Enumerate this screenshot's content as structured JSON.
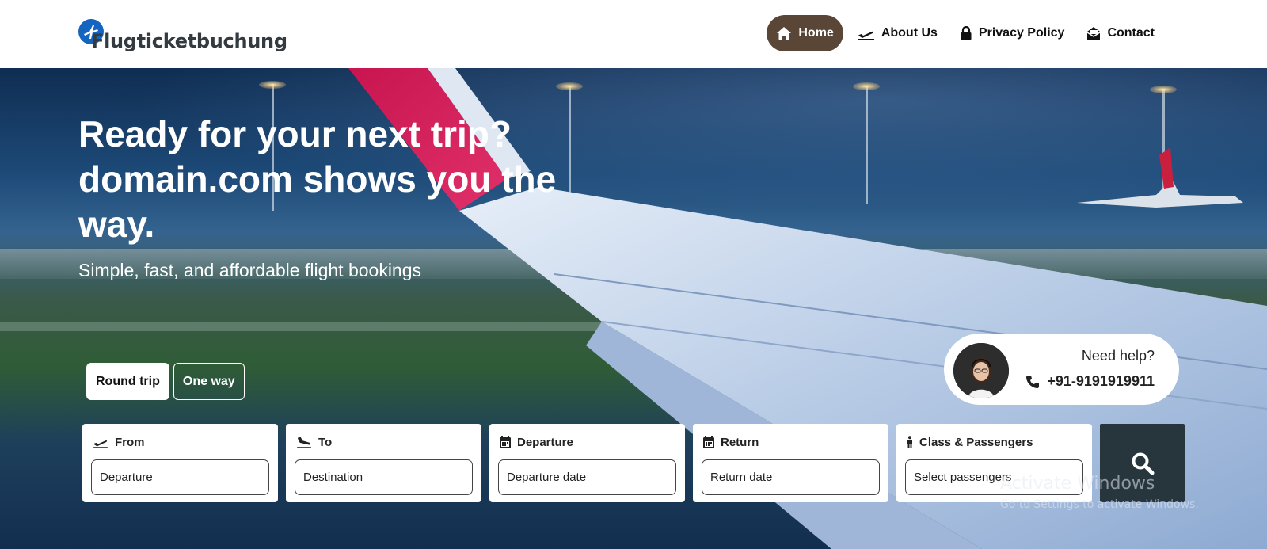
{
  "brand": {
    "name": "Flugticketbuchung",
    "color": "#1565c0"
  },
  "nav": {
    "items": [
      {
        "label": "Home",
        "icon": "home-icon",
        "active": true
      },
      {
        "label": "About Us",
        "icon": "plane-departure-icon",
        "active": false
      },
      {
        "label": "Privacy Policy",
        "icon": "lock-icon",
        "active": false
      },
      {
        "label": "Contact",
        "icon": "envelope-open-icon",
        "active": false
      }
    ],
    "active_color": "#5a4636"
  },
  "hero": {
    "title": "Ready for your next trip? domain.com shows you the way.",
    "subtitle": "Simple, fast, and affordable flight bookings"
  },
  "trip_type": {
    "round_trip": "Round trip",
    "one_way": "One way",
    "selected": "Round trip"
  },
  "help": {
    "title": "Need help?",
    "phone": "+91-9191919911"
  },
  "search": {
    "fields": [
      {
        "label": "From",
        "icon": "plane-departure-icon",
        "placeholder": "Departure"
      },
      {
        "label": "To",
        "icon": "plane-arrival-icon",
        "placeholder": "Destination"
      },
      {
        "label": "Departure",
        "icon": "calendar-icon",
        "placeholder": "Departure date"
      },
      {
        "label": "Return",
        "icon": "calendar-icon",
        "placeholder": "Return date"
      },
      {
        "label": "Class & Passengers",
        "icon": "person-icon",
        "placeholder": "Select passengers"
      }
    ],
    "button_icon": "search-icon",
    "button_color": "#27353d"
  },
  "watermark": {
    "title": "Activate Windows",
    "subtitle": "Go to Settings to activate Windows."
  }
}
